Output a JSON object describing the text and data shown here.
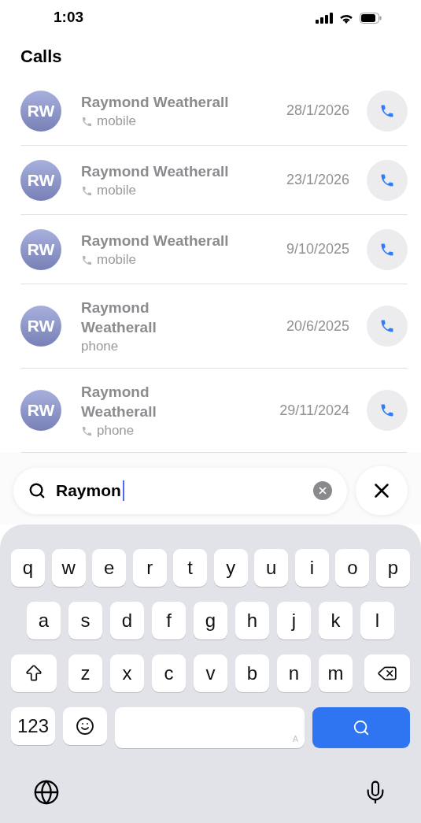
{
  "status_bar": {
    "time": "1:03"
  },
  "header": {
    "title": "Calls"
  },
  "calls": [
    {
      "initials": "RW",
      "name": "Raymond Weatherall",
      "kind": "compact",
      "call_icon": true,
      "type": "mobile",
      "date": "28/1/2026"
    },
    {
      "initials": "RW",
      "name": "Raymond Weatherall",
      "kind": "compact",
      "call_icon": true,
      "type": "mobile",
      "date": "23/1/2026"
    },
    {
      "initials": "RW",
      "name": "Raymond Weatherall",
      "kind": "compact",
      "call_icon": true,
      "type": "mobile",
      "date": "9/10/2025"
    },
    {
      "initials": "RW",
      "name": "Raymond Weatherall",
      "kind": "wrapped",
      "call_icon": false,
      "type": "phone",
      "date": "20/6/2025"
    },
    {
      "initials": "RW",
      "name": "Raymond Weatherall",
      "kind": "wrapped",
      "call_icon": true,
      "type": "phone",
      "date": "29/11/2024"
    }
  ],
  "search": {
    "value": "Raymon"
  },
  "keyboard": {
    "rows": [
      [
        "q",
        "w",
        "e",
        "r",
        "t",
        "y",
        "u",
        "i",
        "o",
        "p"
      ],
      [
        "a",
        "s",
        "d",
        "f",
        "g",
        "h",
        "j",
        "k",
        "l"
      ],
      [
        "z",
        "x",
        "c",
        "v",
        "b",
        "n",
        "m"
      ]
    ],
    "numbers_key": "123",
    "space_hint": "A"
  }
}
